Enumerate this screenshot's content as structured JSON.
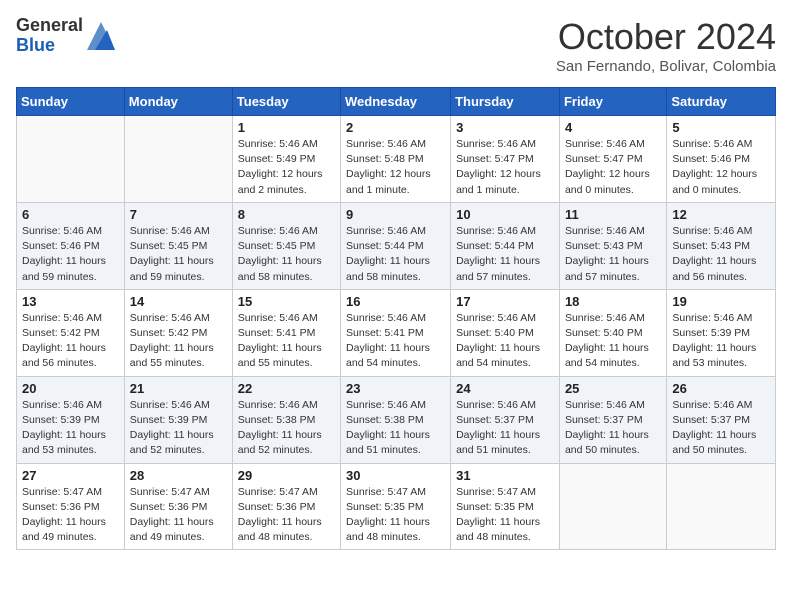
{
  "logo": {
    "general": "General",
    "blue": "Blue"
  },
  "title": "October 2024",
  "subtitle": "San Fernando, Bolivar, Colombia",
  "days_of_week": [
    "Sunday",
    "Monday",
    "Tuesday",
    "Wednesday",
    "Thursday",
    "Friday",
    "Saturday"
  ],
  "weeks": [
    [
      {
        "num": "",
        "info": ""
      },
      {
        "num": "",
        "info": ""
      },
      {
        "num": "1",
        "info": "Sunrise: 5:46 AM\nSunset: 5:49 PM\nDaylight: 12 hours\nand 2 minutes."
      },
      {
        "num": "2",
        "info": "Sunrise: 5:46 AM\nSunset: 5:48 PM\nDaylight: 12 hours\nand 1 minute."
      },
      {
        "num": "3",
        "info": "Sunrise: 5:46 AM\nSunset: 5:47 PM\nDaylight: 12 hours\nand 1 minute."
      },
      {
        "num": "4",
        "info": "Sunrise: 5:46 AM\nSunset: 5:47 PM\nDaylight: 12 hours\nand 0 minutes."
      },
      {
        "num": "5",
        "info": "Sunrise: 5:46 AM\nSunset: 5:46 PM\nDaylight: 12 hours\nand 0 minutes."
      }
    ],
    [
      {
        "num": "6",
        "info": "Sunrise: 5:46 AM\nSunset: 5:46 PM\nDaylight: 11 hours\nand 59 minutes."
      },
      {
        "num": "7",
        "info": "Sunrise: 5:46 AM\nSunset: 5:45 PM\nDaylight: 11 hours\nand 59 minutes."
      },
      {
        "num": "8",
        "info": "Sunrise: 5:46 AM\nSunset: 5:45 PM\nDaylight: 11 hours\nand 58 minutes."
      },
      {
        "num": "9",
        "info": "Sunrise: 5:46 AM\nSunset: 5:44 PM\nDaylight: 11 hours\nand 58 minutes."
      },
      {
        "num": "10",
        "info": "Sunrise: 5:46 AM\nSunset: 5:44 PM\nDaylight: 11 hours\nand 57 minutes."
      },
      {
        "num": "11",
        "info": "Sunrise: 5:46 AM\nSunset: 5:43 PM\nDaylight: 11 hours\nand 57 minutes."
      },
      {
        "num": "12",
        "info": "Sunrise: 5:46 AM\nSunset: 5:43 PM\nDaylight: 11 hours\nand 56 minutes."
      }
    ],
    [
      {
        "num": "13",
        "info": "Sunrise: 5:46 AM\nSunset: 5:42 PM\nDaylight: 11 hours\nand 56 minutes."
      },
      {
        "num": "14",
        "info": "Sunrise: 5:46 AM\nSunset: 5:42 PM\nDaylight: 11 hours\nand 55 minutes."
      },
      {
        "num": "15",
        "info": "Sunrise: 5:46 AM\nSunset: 5:41 PM\nDaylight: 11 hours\nand 55 minutes."
      },
      {
        "num": "16",
        "info": "Sunrise: 5:46 AM\nSunset: 5:41 PM\nDaylight: 11 hours\nand 54 minutes."
      },
      {
        "num": "17",
        "info": "Sunrise: 5:46 AM\nSunset: 5:40 PM\nDaylight: 11 hours\nand 54 minutes."
      },
      {
        "num": "18",
        "info": "Sunrise: 5:46 AM\nSunset: 5:40 PM\nDaylight: 11 hours\nand 54 minutes."
      },
      {
        "num": "19",
        "info": "Sunrise: 5:46 AM\nSunset: 5:39 PM\nDaylight: 11 hours\nand 53 minutes."
      }
    ],
    [
      {
        "num": "20",
        "info": "Sunrise: 5:46 AM\nSunset: 5:39 PM\nDaylight: 11 hours\nand 53 minutes."
      },
      {
        "num": "21",
        "info": "Sunrise: 5:46 AM\nSunset: 5:39 PM\nDaylight: 11 hours\nand 52 minutes."
      },
      {
        "num": "22",
        "info": "Sunrise: 5:46 AM\nSunset: 5:38 PM\nDaylight: 11 hours\nand 52 minutes."
      },
      {
        "num": "23",
        "info": "Sunrise: 5:46 AM\nSunset: 5:38 PM\nDaylight: 11 hours\nand 51 minutes."
      },
      {
        "num": "24",
        "info": "Sunrise: 5:46 AM\nSunset: 5:37 PM\nDaylight: 11 hours\nand 51 minutes."
      },
      {
        "num": "25",
        "info": "Sunrise: 5:46 AM\nSunset: 5:37 PM\nDaylight: 11 hours\nand 50 minutes."
      },
      {
        "num": "26",
        "info": "Sunrise: 5:46 AM\nSunset: 5:37 PM\nDaylight: 11 hours\nand 50 minutes."
      }
    ],
    [
      {
        "num": "27",
        "info": "Sunrise: 5:47 AM\nSunset: 5:36 PM\nDaylight: 11 hours\nand 49 minutes."
      },
      {
        "num": "28",
        "info": "Sunrise: 5:47 AM\nSunset: 5:36 PM\nDaylight: 11 hours\nand 49 minutes."
      },
      {
        "num": "29",
        "info": "Sunrise: 5:47 AM\nSunset: 5:36 PM\nDaylight: 11 hours\nand 48 minutes."
      },
      {
        "num": "30",
        "info": "Sunrise: 5:47 AM\nSunset: 5:35 PM\nDaylight: 11 hours\nand 48 minutes."
      },
      {
        "num": "31",
        "info": "Sunrise: 5:47 AM\nSunset: 5:35 PM\nDaylight: 11 hours\nand 48 minutes."
      },
      {
        "num": "",
        "info": ""
      },
      {
        "num": "",
        "info": ""
      }
    ]
  ]
}
